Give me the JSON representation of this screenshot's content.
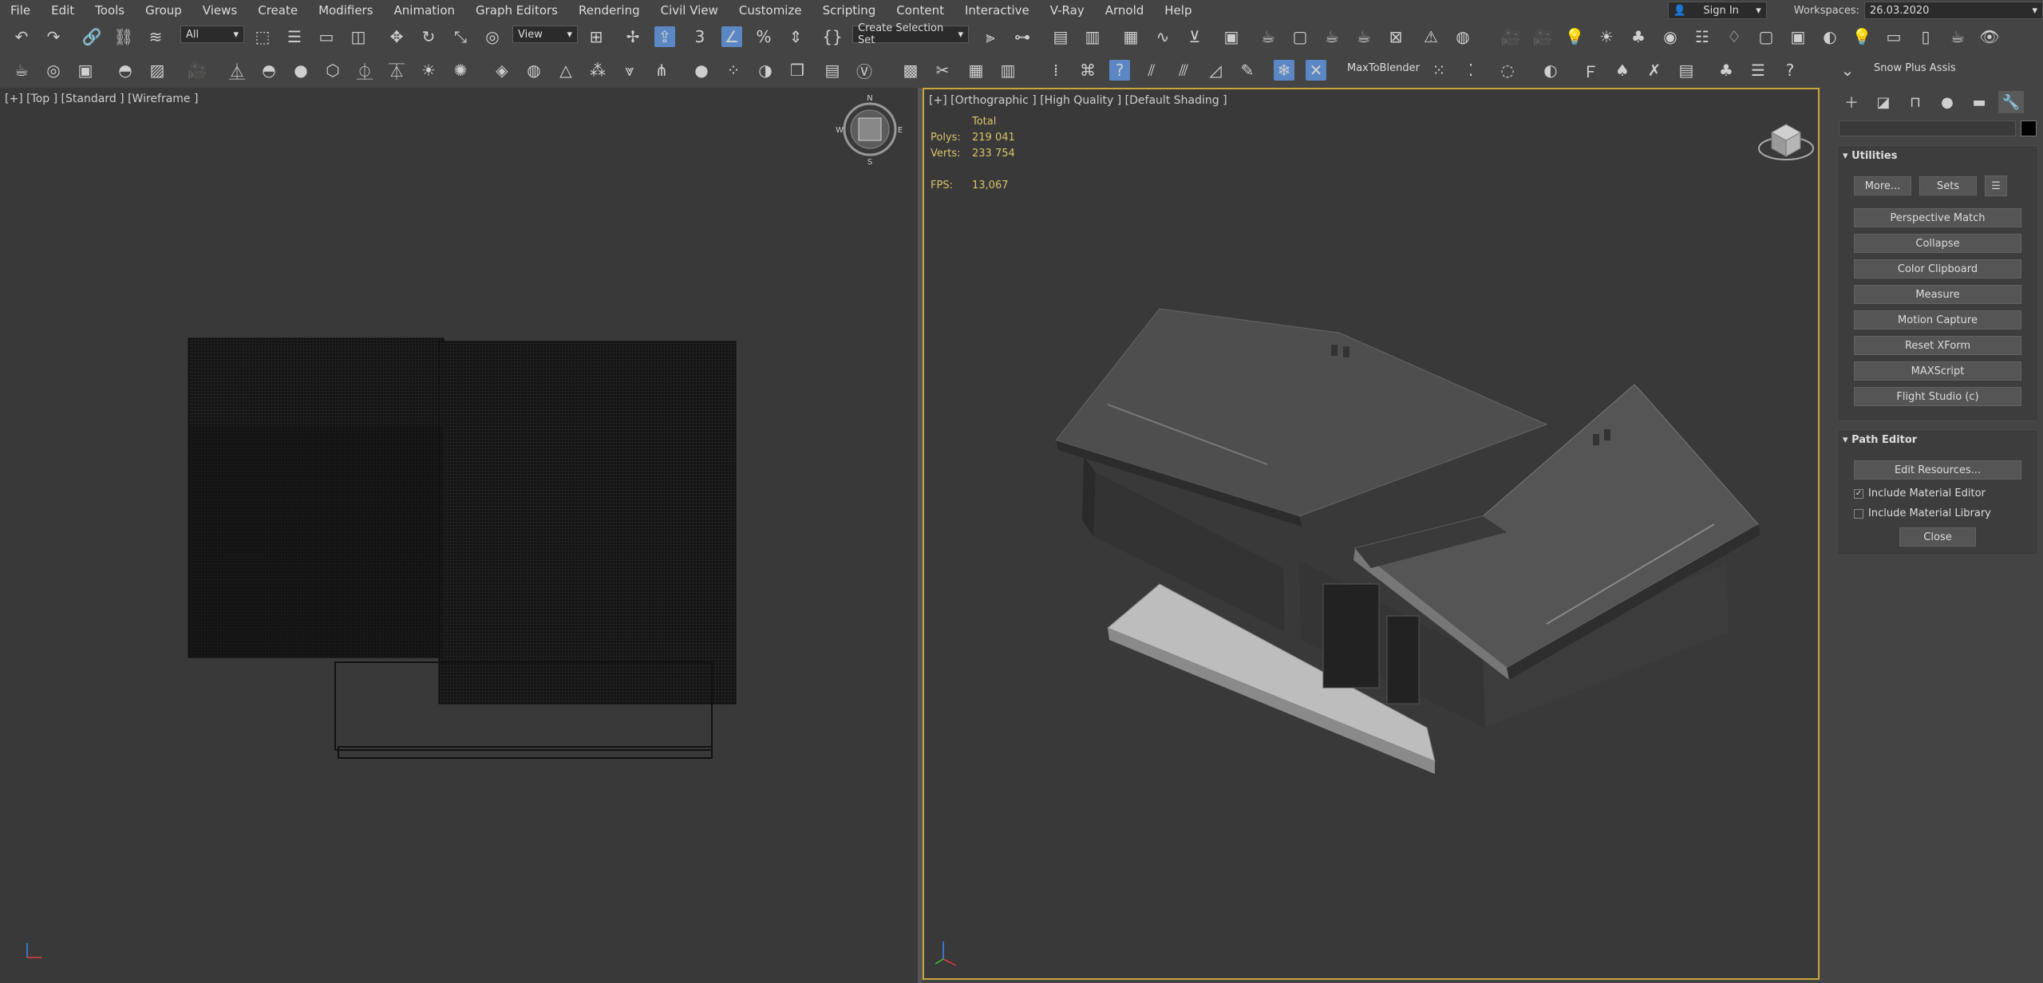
{
  "menu": [
    "File",
    "Edit",
    "Tools",
    "Group",
    "Views",
    "Create",
    "Modifiers",
    "Animation",
    "Graph Editors",
    "Rendering",
    "Civil View",
    "Customize",
    "Scripting",
    "Content",
    "Interactive",
    "V-Ray",
    "Arnold",
    "Help"
  ],
  "signin": "Sign In",
  "workspaces": {
    "label": "Workspaces:",
    "value": "26.03.2020"
  },
  "toolbar": {
    "filter": "All",
    "refcoord": "View",
    "selection_set": "Create Selection Set",
    "maxtoblender": "MaxToBlender",
    "snow": "Snow Plus Assis"
  },
  "viewport_left": {
    "label": "[+] [Top ] [Standard ] [Wireframe ]"
  },
  "viewport_right": {
    "label": "[+] [Orthographic ] [High Quality ] [Default Shading ]",
    "stats": {
      "header": "Total",
      "polys_label": "Polys:",
      "polys": "219 041",
      "verts_label": "Verts:",
      "verts": "233 754",
      "fps_label": "FPS:",
      "fps": "13,067"
    }
  },
  "panel": {
    "utilities": {
      "title": "Utilities",
      "more": "More...",
      "sets": "Sets",
      "buttons": [
        "Perspective Match",
        "Collapse",
        "Color Clipboard",
        "Measure",
        "Motion Capture",
        "Reset XForm",
        "MAXScript",
        "Flight Studio (c)"
      ]
    },
    "path_editor": {
      "title": "Path Editor",
      "edit_resources": "Edit Resources...",
      "include_material_editor": "Include Material Editor",
      "include_material_library": "Include Material Library",
      "close": "Close"
    }
  },
  "icons": [
    "undo-icon",
    "redo-icon",
    "link-icon",
    "unlink-icon",
    "bind-icon",
    "select-icon",
    "move-icon",
    "rotate-icon",
    "scale-icon",
    "snap-icon",
    "angle-snap-icon",
    "mirror-icon",
    "align-icon",
    "render-icon",
    "teapot-icon",
    "plus-icon",
    "modify-icon",
    "hierarchy-icon",
    "motion-icon",
    "display-icon",
    "utilities-icon"
  ]
}
